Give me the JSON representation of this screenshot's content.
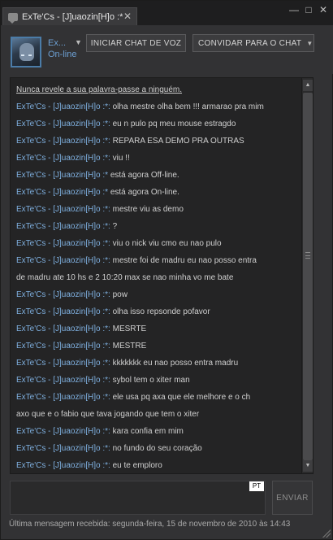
{
  "window": {
    "tab_title": "ExTe'Cs - [J]uaozin[H]o :*",
    "tab_close": "✕",
    "minimize": "—",
    "maximize": "□",
    "close": "✕"
  },
  "header": {
    "username": "Ex...",
    "status": "On-line",
    "voice_button": "INICIAR CHAT DE VOZ",
    "invite_button": "CONVIDAR PARA O CHAT",
    "invite_caret": "▼",
    "user_caret": "▼"
  },
  "chat": {
    "warning": "Nunca revele a sua palavra-passe a ninguém.",
    "lines": [
      {
        "sender": "ExTe'Cs - [J]uaozin[H]o :*:",
        "text": " olha mestre olha bem !!! armarao pra mim"
      },
      {
        "sender": "ExTe'Cs - [J]uaozin[H]o :*:",
        "text": " eu n pulo pq meu mouse estragdo"
      },
      {
        "sender": "ExTe'Cs - [J]uaozin[H]o :*:",
        "text": " REPARA ESA DEMO PRA OUTRAS"
      },
      {
        "sender": "ExTe'Cs - [J]uaozin[H]o :*:",
        "text": " viu !!"
      },
      {
        "sender": "ExTe'Cs - [J]uaozin[H]o :*",
        "text": " está agora Off-line."
      },
      {
        "sender": "ExTe'Cs - [J]uaozin[H]o :*",
        "text": " está agora On-line."
      },
      {
        "sender": "ExTe'Cs - [J]uaozin[H]o :*:",
        "text": " mestre viu as demo"
      },
      {
        "sender": "ExTe'Cs - [J]uaozin[H]o :*:",
        "text": " ?"
      },
      {
        "sender": "ExTe'Cs - [J]uaozin[H]o :*:",
        "text": " viu o nick viu cmo eu nao pulo"
      },
      {
        "sender": "ExTe'Cs - [J]uaozin[H]o :*:",
        "text": " mestre foi de madru eu nao posso entra"
      },
      {
        "sender": "",
        "text": "de madru ate 10 hs e 2 10:20 max se nao minha vo me bate"
      },
      {
        "sender": "ExTe'Cs - [J]uaozin[H]o :*:",
        "text": " pow"
      },
      {
        "sender": "ExTe'Cs - [J]uaozin[H]o :*:",
        "text": " olha isso repsonde pofavor"
      },
      {
        "sender": "ExTe'Cs - [J]uaozin[H]o :*:",
        "text": " MESRTE"
      },
      {
        "sender": "ExTe'Cs - [J]uaozin[H]o :*:",
        "text": " MESTRE"
      },
      {
        "sender": "ExTe'Cs - [J]uaozin[H]o :*:",
        "text": " kkkkkkk eu nao posso entra madru"
      },
      {
        "sender": "ExTe'Cs - [J]uaozin[H]o :*:",
        "text": " sybol tem o xiter man"
      },
      {
        "sender": "ExTe'Cs - [J]uaozin[H]o :*:",
        "text": " ele usa pq axa que ele melhore e o ch"
      },
      {
        "sender": "",
        "text": "axo que e o fabio que tava jogando que tem o xiter"
      },
      {
        "sender": "ExTe'Cs - [J]uaozin[H]o :*:",
        "text": " kara confia em mim"
      },
      {
        "sender": "ExTe'Cs - [J]uaozin[H]o :*:",
        "text": " no fundo do seu coração"
      },
      {
        "sender": "ExTe'Cs - [J]uaozin[H]o :*:",
        "text": " eu te emploro"
      }
    ]
  },
  "input": {
    "value": "",
    "language_badge": "PT",
    "send_button": "ENVIAR"
  },
  "footer": {
    "last_message": "Última mensagem recebida: segunda-feira, 15 de novembro de 2010 às 14:43"
  }
}
